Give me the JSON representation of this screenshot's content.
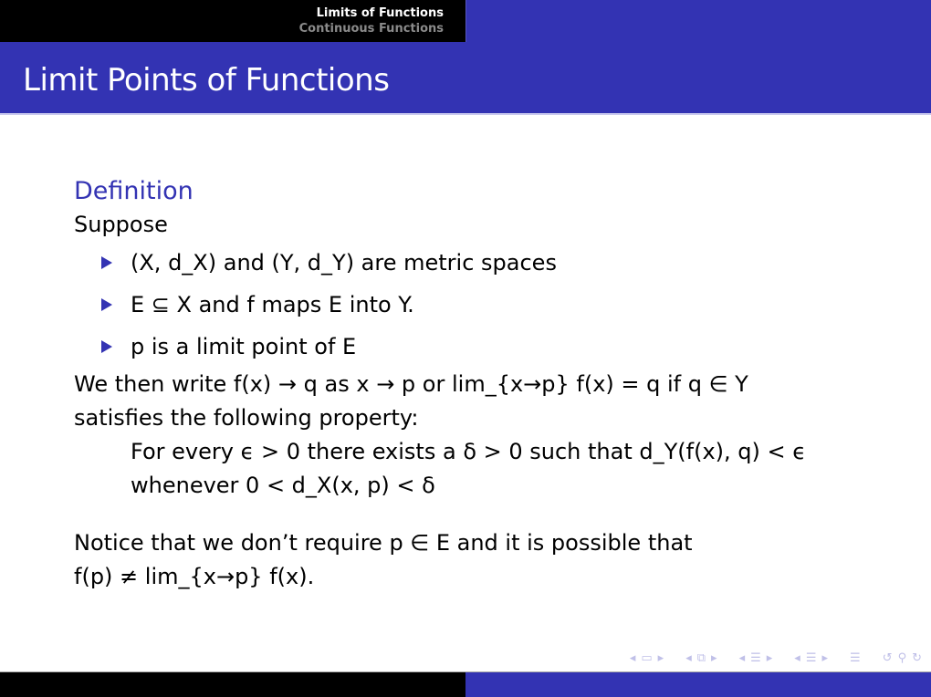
{
  "headline": {
    "current_section": "Limits of Functions",
    "other_section": "Continuous Functions"
  },
  "frame": {
    "title": "Limit Points of Functions"
  },
  "block": {
    "title": "Definition",
    "intro": "Suppose",
    "items": [
      "(X, d_X) and (Y, d_Y) are metric spaces",
      "E ⊆ X and f maps E into Y.",
      "p is a limit point of E"
    ],
    "line1": "We then write f(x) → q as x → p or lim_{x→p} f(x) = q if q ∈ Y",
    "line2": "satisfies the following property:",
    "property_line1": "For every ϵ > 0 there exists a δ > 0 such that d_Y(f(x), q) < ϵ",
    "property_line2": "whenever 0 < d_X(x, p) < δ"
  },
  "notice": {
    "line1": "Notice that we don’t require p ∈ E and it is possible that",
    "line2": "f(p) ≠ lim_{x→p} f(x)."
  },
  "navigation": {
    "icons": [
      "nav-prev-arrow",
      "frame-icon",
      "nav-next-arrow",
      "nav-prev-arrow",
      "subsection-icon",
      "nav-next-arrow",
      "nav-prev-arrow",
      "section-icon",
      "nav-next-arrow",
      "nav-prev-arrow",
      "section-icon",
      "nav-next-arrow",
      "document-icon",
      "back-icon",
      "search-icon",
      "forward-icon"
    ]
  },
  "colors": {
    "accent": "#3333b3",
    "headline_bg": "#000000",
    "nav_icons": "#c0c0e8"
  }
}
